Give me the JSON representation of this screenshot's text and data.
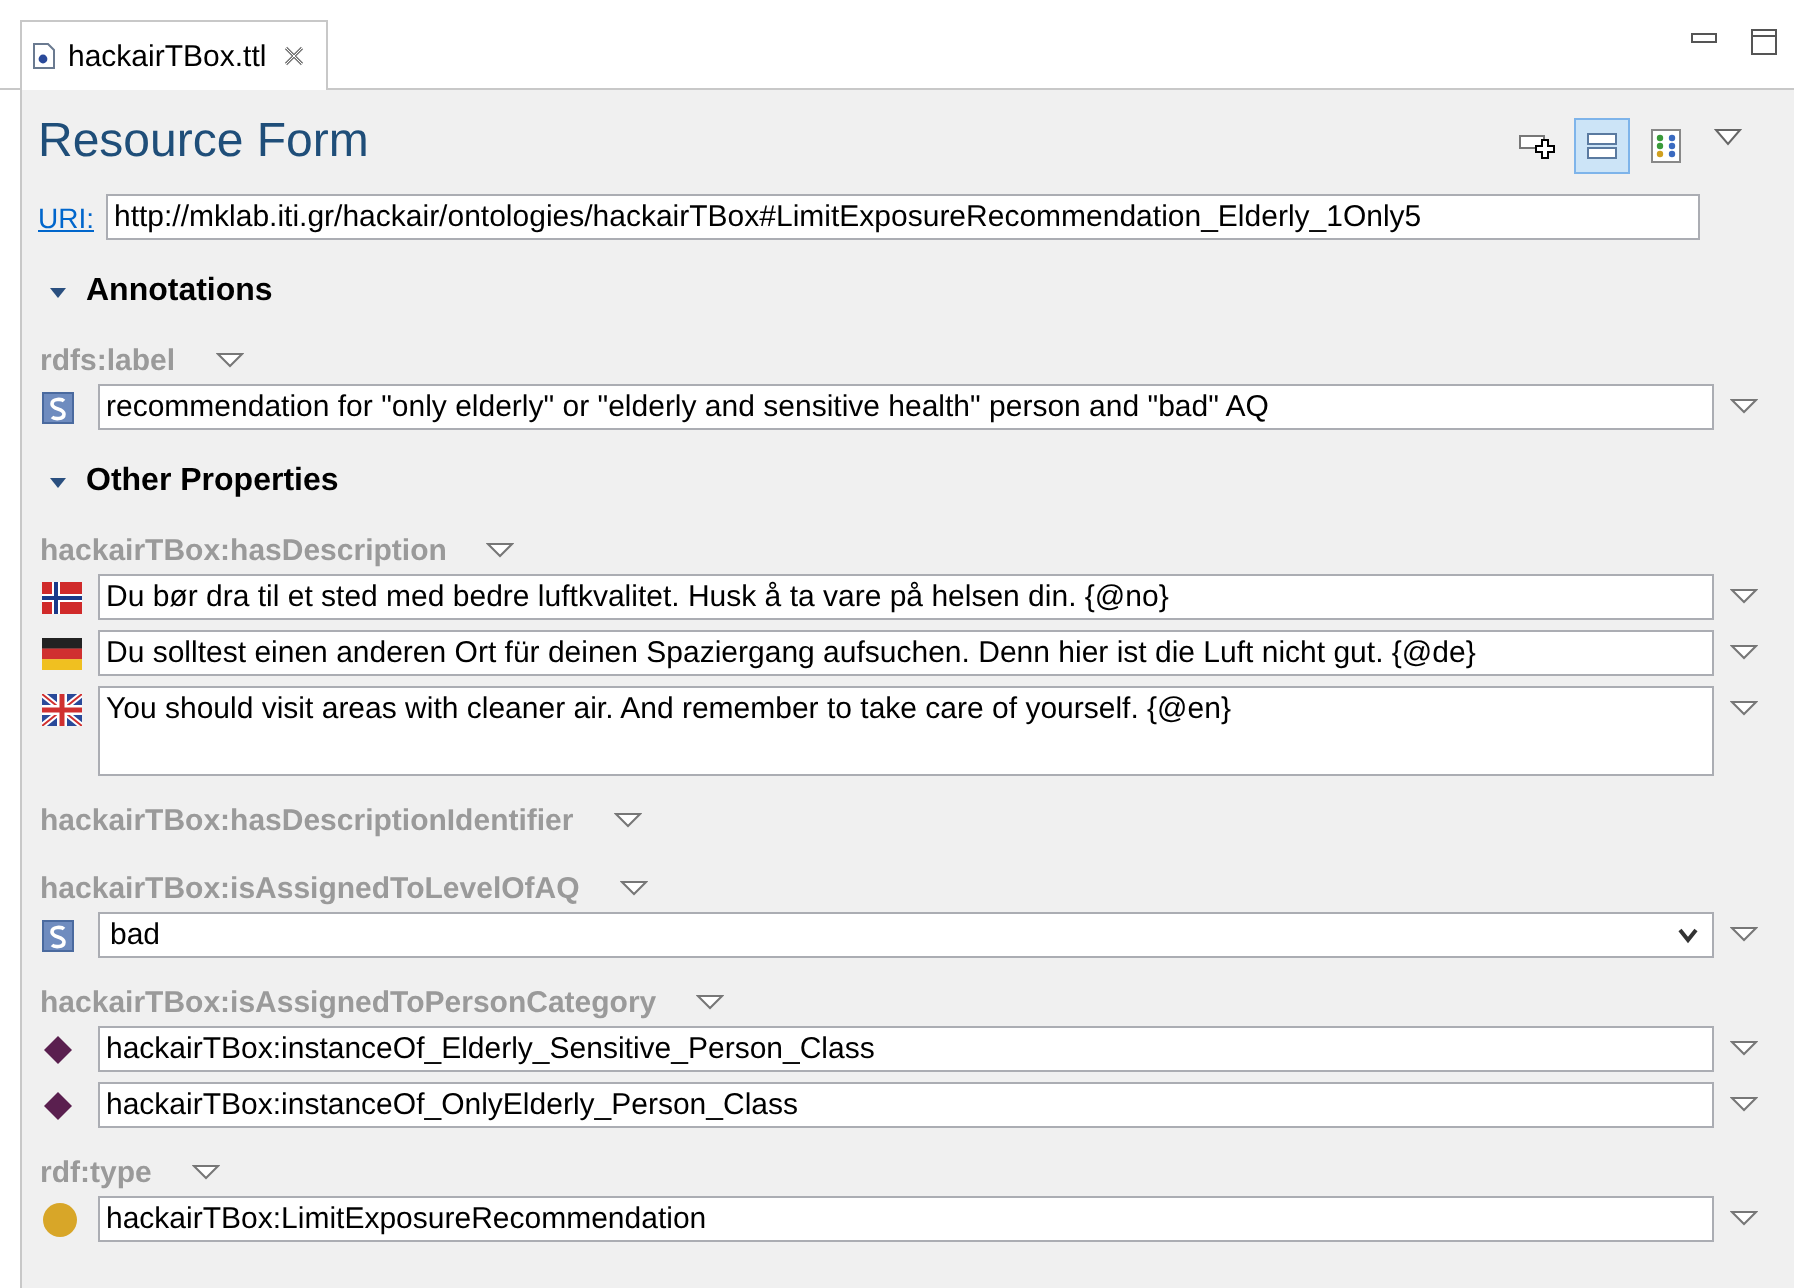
{
  "tab": {
    "label": "hackairTBox.ttl",
    "selected": true
  },
  "title": "Resource Form",
  "toolbar": [
    {
      "kind": "add",
      "selected": false
    },
    {
      "kind": "form",
      "selected": true
    },
    {
      "kind": "grid",
      "selected": false
    }
  ],
  "uri": {
    "label": "URI:",
    "value": "http://mklab.iti.gr/hackair/ontologies/hackairTBox#LimitExposureRecommendation_Elderly_1Only5"
  },
  "sections": [
    {
      "title": "Annotations",
      "expanded": true,
      "properties": [
        {
          "name": "rdfs:label",
          "values": [
            {
              "kind": "string",
              "multiline": false,
              "dropdown": false,
              "text": "recommendation for \"only elderly\" or \"elderly and sensitive health\" person and \"bad\" AQ"
            }
          ]
        }
      ]
    },
    {
      "title": "Other Properties",
      "expanded": true,
      "properties": [
        {
          "name": "hackairTBox:hasDescription",
          "values": [
            {
              "kind": "norwegian",
              "multiline": false,
              "dropdown": false,
              "text": "Du bør dra til et sted med bedre luftkvalitet. Husk å ta vare på helsen din. {@no}"
            },
            {
              "kind": "german",
              "multiline": false,
              "dropdown": false,
              "text": "Du solltest einen anderen Ort für deinen Spaziergang aufsuchen. Denn hier ist die Luft nicht gut. {@de}"
            },
            {
              "kind": "english",
              "multiline": true,
              "dropdown": false,
              "text": "You should visit areas with cleaner air. And remember to take care of yourself. {@en}"
            }
          ]
        },
        {
          "name": "hackairTBox:hasDescriptionIdentifier"
        },
        {
          "name": "hackairTBox:isAssignedToLevelOfAQ",
          "values": [
            {
              "kind": "string",
              "multiline": false,
              "dropdown": true,
              "text": "bad"
            }
          ]
        },
        {
          "name": "hackairTBox:isAssignedToPersonCategory",
          "values": [
            {
              "kind": "individual",
              "multiline": false,
              "dropdown": false,
              "text": "hackairTBox:instanceOf_Elderly_Sensitive_Person_Class"
            },
            {
              "kind": "individual",
              "multiline": false,
              "dropdown": false,
              "text": "hackairTBox:instanceOf_OnlyElderly_Person_Class"
            }
          ]
        },
        {
          "name": "rdf:type",
          "values": [
            {
              "kind": "class",
              "multiline": false,
              "dropdown": false,
              "text": "hackairTBox:LimitExposureRecommendation"
            }
          ]
        }
      ]
    }
  ]
}
